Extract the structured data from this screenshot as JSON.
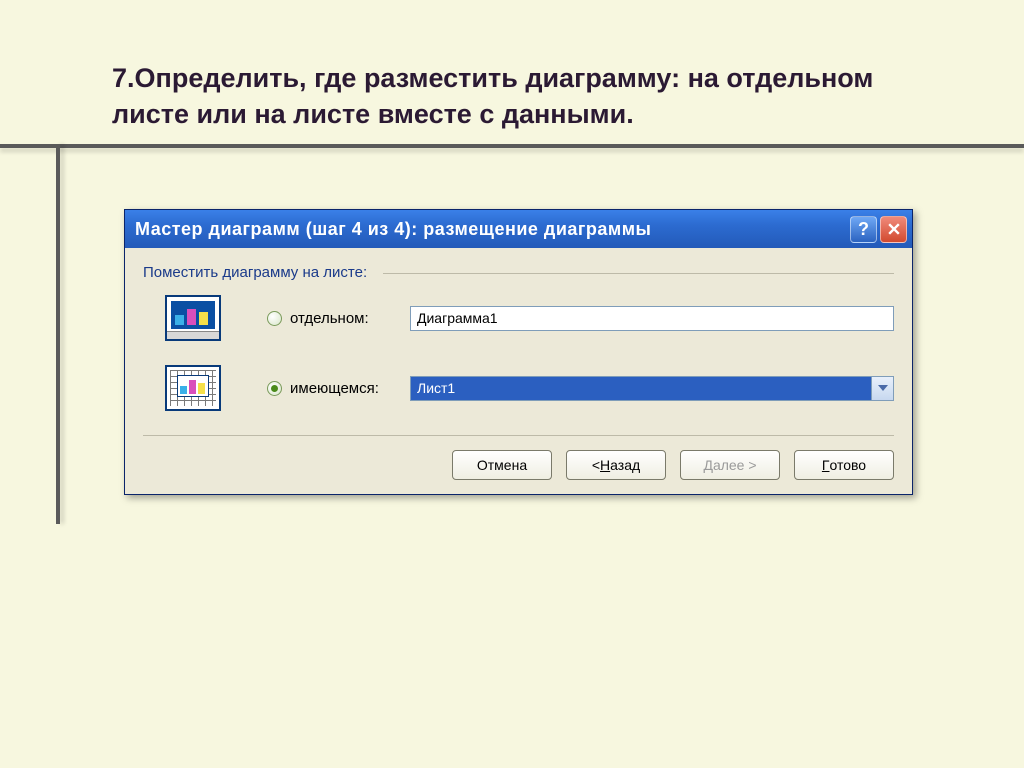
{
  "slide": {
    "title": "7.Определить, где разместить диаграмму: на отдельном листе или на листе вместе с данными."
  },
  "dialog": {
    "title": "Мастер диаграмм (шаг 4 из 4): размещение диаграммы",
    "group_label": "Поместить диаграмму на листе:",
    "options": {
      "separate": {
        "label": "отдельном:",
        "value": "Диаграмма1",
        "checked": false
      },
      "existing": {
        "label": "имеющемся:",
        "value": "Лист1",
        "checked": true
      }
    },
    "buttons": {
      "cancel": "Отмена",
      "back_prefix": "< ",
      "back_u": "Н",
      "back_rest": "азад",
      "next_u": "Д",
      "next_rest": "алее >",
      "finish_u": "Г",
      "finish_rest": "отово"
    }
  }
}
